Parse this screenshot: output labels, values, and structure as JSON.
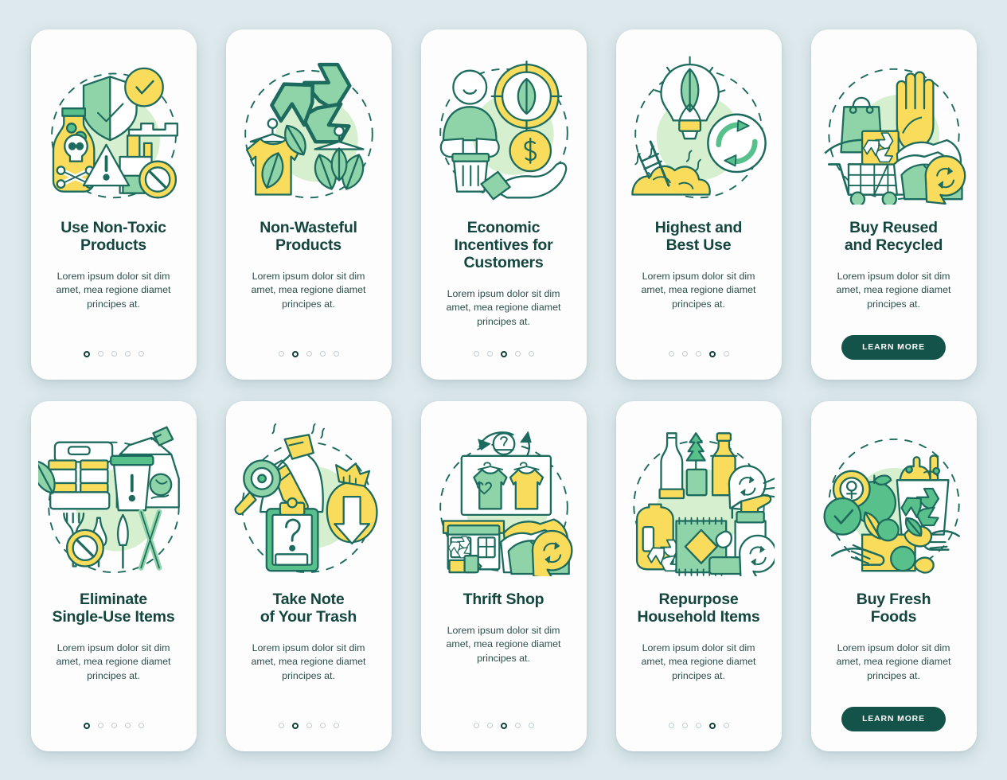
{
  "theme": {
    "background": "#dde9ec",
    "card_background": "#fdfdfd",
    "title_color": "#14463f",
    "body_color": "#2d4f4c",
    "accent_green": "#14534a",
    "illustration_green": "#58c08a",
    "illustration_yellow": "#f9dc5c",
    "illustration_outline": "#1d6b5e",
    "illustration_circle": "#d6f0cf",
    "dot_inactive": "#c3ced2",
    "dot_active": "#12403a"
  },
  "shared": {
    "body_text": "Lorem ipsum dolor sit dim amet, mea regione diamet principes at.",
    "learn_more_label": "LEARN MORE",
    "dot_count": 5
  },
  "cards": [
    {
      "id": "use-non-toxic-products",
      "title": "Use Non-Toxic Products",
      "title_lines": [
        "Use Non-Toxic",
        "Products"
      ],
      "body": "Lorem ipsum dolor sit dim amet, mea regione diamet principes at.",
      "footer_type": "dots",
      "active_dot": 0,
      "illustration": "shield-check-hazard-factory"
    },
    {
      "id": "non-wasteful-products",
      "title": "Non-Wasteful Products",
      "title_lines": [
        "Non-Wasteful",
        "Products"
      ],
      "body": "Lorem ipsum dolor sit dim amet, mea regione diamet principes at.",
      "footer_type": "dots",
      "active_dot": 1,
      "illustration": "recycle-tshirt-hanger-leaves"
    },
    {
      "id": "economic-incentives-for-customers",
      "title": "Economic Incentives for Customers",
      "title_lines": [
        "Economic",
        "Incentives for",
        "Customers"
      ],
      "body": "Lorem ipsum dolor sit dim amet, mea regione diamet principes at.",
      "footer_type": "dots",
      "active_dot": 2,
      "illustration": "shopper-leaf-coin-dollar-hand"
    },
    {
      "id": "highest-and-best-use",
      "title": "Highest and Best Use",
      "title_lines": [
        "Highest and",
        "Best Use"
      ],
      "body": "Lorem ipsum dolor sit dim amet, mea regione diamet principes at.",
      "footer_type": "dots",
      "active_dot": 3,
      "illustration": "lightbulb-leaf-compost-recycle"
    },
    {
      "id": "buy-reused-and-recycled",
      "title": "Buy Reused and Recycled",
      "title_lines": [
        "Buy Reused",
        "and Recycled"
      ],
      "body": "Lorem ipsum dolor sit dim amet, mea regione diamet principes at.",
      "footer_type": "button",
      "active_dot": 4,
      "illustration": "bag-stophand-cart-clothes"
    },
    {
      "id": "eliminate-single-use-items",
      "title": "Eliminate Single-Use Items",
      "title_lines": [
        "Eliminate",
        "Single-Use Items"
      ],
      "body": "Lorem ipsum dolor sit dim amet, mea regione diamet principes at.",
      "footer_type": "dots",
      "active_dot": 0,
      "illustration": "lunchbox-cup-cutlery-nosign"
    },
    {
      "id": "take-note-of-your-trash",
      "title": "Take Note of Your Trash",
      "title_lines": [
        "Take Note",
        "of Your Trash"
      ],
      "body": "Lorem ipsum dolor sit dim amet, mea regione diamet principes at.",
      "footer_type": "dots",
      "active_dot": 1,
      "illustration": "magnifier-trash-clipboard-bag"
    },
    {
      "id": "thrift-shop",
      "title": "Thrift Shop",
      "title_lines": [
        "Thrift Shop"
      ],
      "body": "Lorem ipsum dolor sit dim amet, mea regione diamet principes at.",
      "footer_type": "dots",
      "active_dot": 2,
      "illustration": "hangers-store-clothes-recycle"
    },
    {
      "id": "repurpose-household-items",
      "title": "Repurpose Household Items",
      "title_lines": [
        "Repurpose",
        "Household Items"
      ],
      "body": "Lorem ipsum dolor sit dim amet, mea regione diamet principes at.",
      "footer_type": "dots",
      "active_dot": 3,
      "illustration": "bottles-rug-spray-recycle"
    },
    {
      "id": "buy-fresh-foods",
      "title": "Buy Fresh Foods",
      "title_lines": [
        "Buy Fresh",
        "Foods"
      ],
      "body": "Lorem ipsum dolor sit dim amet, mea regione diamet principes at.",
      "footer_type": "button",
      "active_dot": 4,
      "illustration": "produce-bin-grocerybag-hands"
    }
  ]
}
